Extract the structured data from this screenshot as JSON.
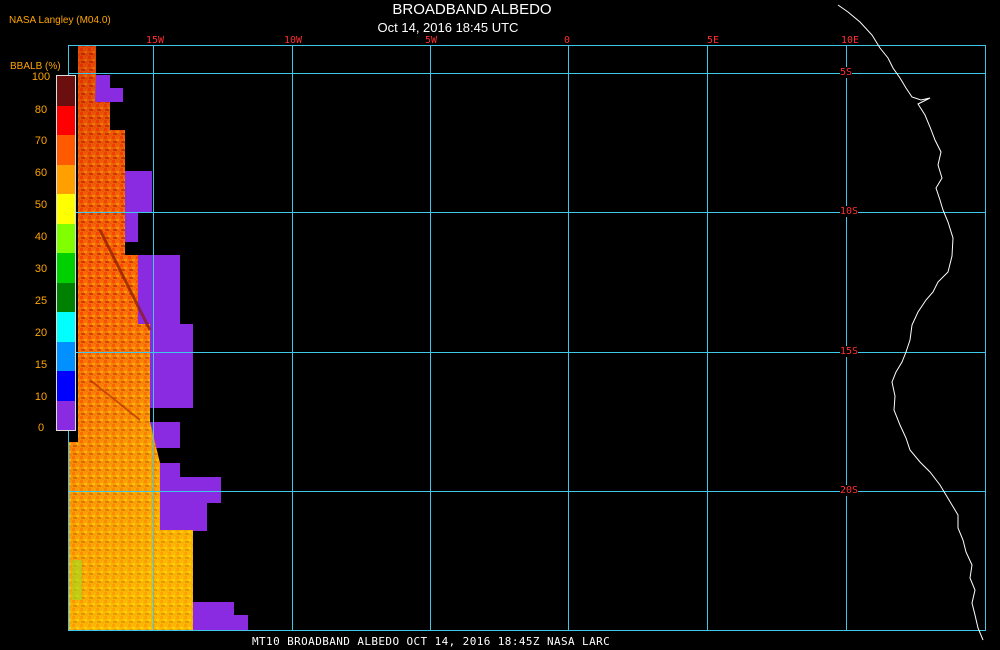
{
  "header": {
    "title": "BROADBAND ALBEDO",
    "subtitle": "Oct 14, 2016 18:45 UTC",
    "credit": "NASA Langley (M04.0)"
  },
  "legend": {
    "unit": "BBALB (%)",
    "ticks": [
      "100",
      "80",
      "70",
      "60",
      "50",
      "40",
      "30",
      "25",
      "20",
      "15",
      "10",
      "0"
    ],
    "colors": [
      "#6b0e0e",
      "#ff0000",
      "#ff5a00",
      "#ffa000",
      "#ffff00",
      "#80ff00",
      "#00d000",
      "#008000",
      "#00ffff",
      "#0090ff",
      "#0000ff",
      "#8a2be2"
    ]
  },
  "map": {
    "longitude_labels": [
      "15W",
      "10W",
      "5W",
      "0",
      "5E",
      "10E"
    ],
    "latitude_labels": [
      "5S",
      "10S",
      "15S",
      "20S"
    ],
    "grid_color": "#3fc8e8",
    "coast_color": "#ffffff",
    "no_data_color": "#8a2be2"
  },
  "footer": {
    "caption": "MT10  BROADBAND ALBEDO  OCT 14, 2016 18:45Z  NASA LARC"
  }
}
